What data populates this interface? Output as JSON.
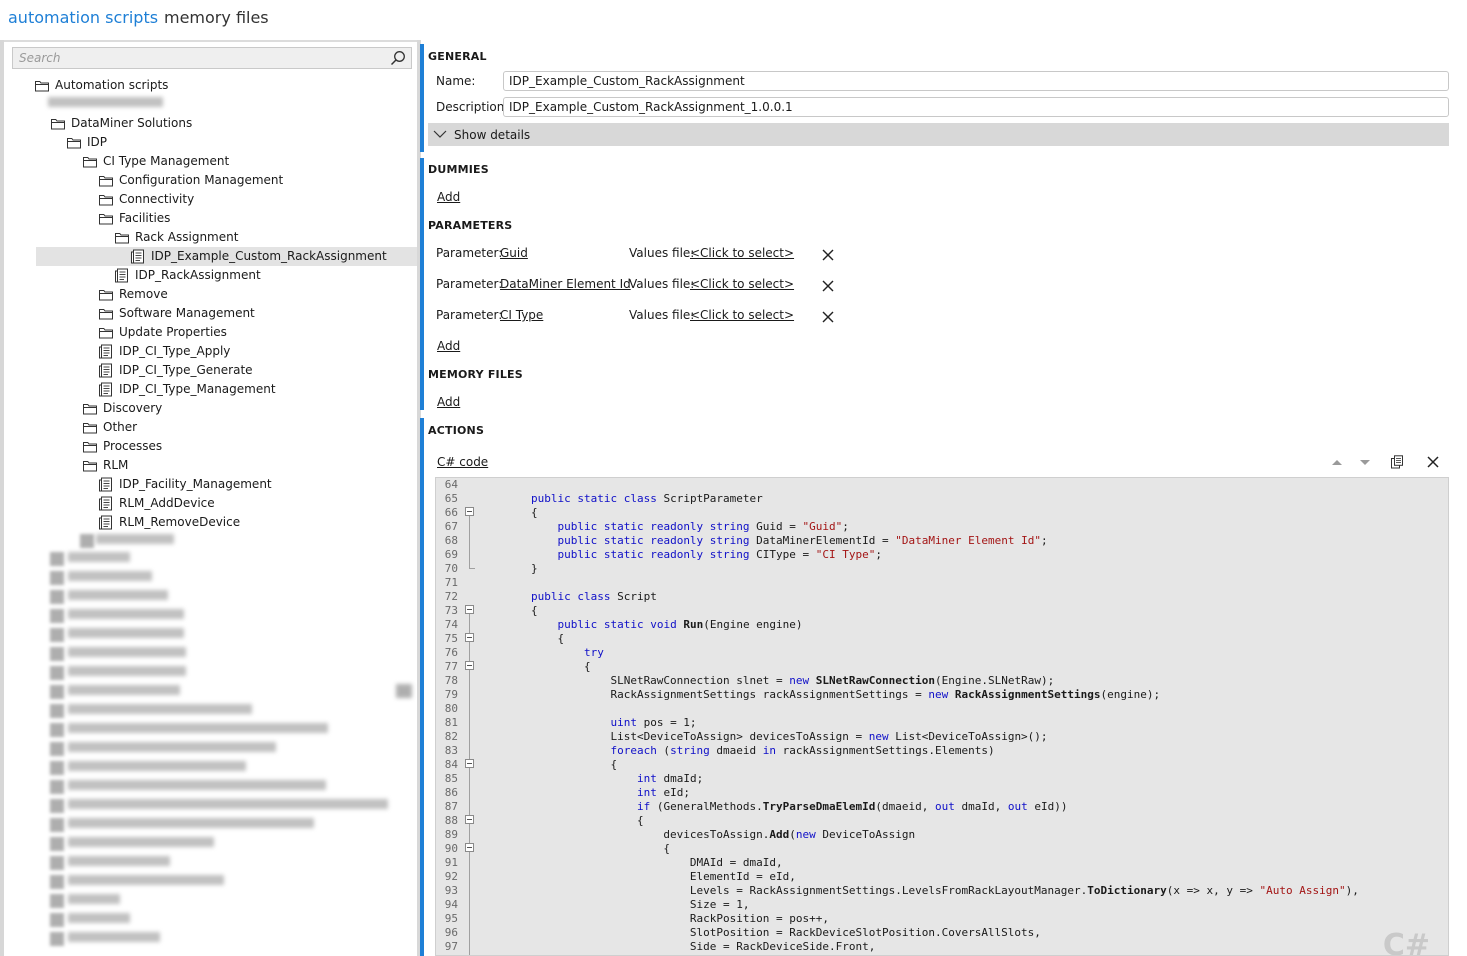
{
  "tabs": [
    {
      "label": "automation scripts",
      "active": true
    },
    {
      "label": "memory files",
      "active": false
    }
  ],
  "search": {
    "placeholder": "Search"
  },
  "tree": [
    {
      "label": "Automation scripts",
      "type": "folder",
      "level": 0
    },
    {
      "label": "DataMiner Solutions",
      "type": "folder",
      "level": 1
    },
    {
      "label": "IDP",
      "type": "folder",
      "level": 2
    },
    {
      "label": "CI Type Management",
      "type": "folder",
      "level": 3
    },
    {
      "label": "Configuration Management",
      "type": "folder",
      "level": 4
    },
    {
      "label": "Connectivity",
      "type": "folder",
      "level": 4
    },
    {
      "label": "Facilities",
      "type": "folder",
      "level": 4
    },
    {
      "label": "Rack Assignment",
      "type": "folder",
      "level": 5
    },
    {
      "label": "IDP_Example_Custom_RackAssignment",
      "type": "script",
      "level": 6,
      "selected": true
    },
    {
      "label": "IDP_RackAssignment",
      "type": "script",
      "level": 5
    },
    {
      "label": "Remove",
      "type": "folder",
      "level": 4
    },
    {
      "label": "Software Management",
      "type": "folder",
      "level": 4
    },
    {
      "label": "Update Properties",
      "type": "folder",
      "level": 4
    },
    {
      "label": "IDP_CI_Type_Apply",
      "type": "script",
      "level": 4
    },
    {
      "label": "IDP_CI_Type_Generate",
      "type": "script",
      "level": 4
    },
    {
      "label": "IDP_CI_Type_Management",
      "type": "script",
      "level": 4
    },
    {
      "label": "Discovery",
      "type": "folder",
      "level": 3
    },
    {
      "label": "Other",
      "type": "folder",
      "level": 3
    },
    {
      "label": "Processes",
      "type": "folder",
      "level": 3
    },
    {
      "label": "RLM",
      "type": "folder",
      "level": 3
    },
    {
      "label": "IDP_Facility_Management",
      "type": "script",
      "level": 4
    },
    {
      "label": "RLM_AddDevice",
      "type": "script",
      "level": 4
    },
    {
      "label": "RLM_RemoveDevice",
      "type": "script",
      "level": 4
    }
  ],
  "general": {
    "title": "GENERAL",
    "name_label": "Name:",
    "name_value": "IDP_Example_Custom_RackAssignment",
    "description_label": "Description:",
    "description_value": "IDP_Example_Custom_RackAssignment_1.0.0.1",
    "show_details": "Show details"
  },
  "dummies": {
    "title": "DUMMIES",
    "add": "Add"
  },
  "parameters": {
    "title": "PARAMETERS",
    "add": "Add",
    "items": [
      {
        "label": "Parameter:",
        "name": "Guid",
        "values_label": "Values file:",
        "values_link": "<Click to select>"
      },
      {
        "label": "Parameter:",
        "name": "DataMiner Element Id",
        "values_label": "Values file:",
        "values_link": "<Click to select>"
      },
      {
        "label": "Parameter:",
        "name": "CI Type",
        "values_label": "Values file:",
        "values_link": "<Click to select>"
      }
    ]
  },
  "memory_files": {
    "title": "MEMORY FILES",
    "add": "Add"
  },
  "actions": {
    "title": "ACTIONS",
    "code_tab": "C# code",
    "watermark": "C#",
    "line_numbers": [
      64,
      65,
      66,
      67,
      68,
      69,
      70,
      71,
      72,
      73,
      74,
      75,
      76,
      77,
      78,
      79,
      80,
      81,
      82,
      83,
      84,
      85,
      86,
      87,
      88,
      89,
      90,
      91,
      92,
      93,
      94,
      95,
      96,
      97
    ],
    "code_lines": [
      [],
      [
        [
          "        ",
          ""
        ],
        [
          "public static class",
          "kw"
        ],
        [
          " ScriptParameter",
          ""
        ]
      ],
      [
        [
          "        {",
          ""
        ]
      ],
      [
        [
          "            ",
          ""
        ],
        [
          "public static readonly string",
          "kw"
        ],
        [
          " Guid = ",
          ""
        ],
        [
          "\"Guid\"",
          "str"
        ],
        [
          ";",
          ""
        ]
      ],
      [
        [
          "            ",
          ""
        ],
        [
          "public static readonly string",
          "kw"
        ],
        [
          " DataMinerElementId = ",
          ""
        ],
        [
          "\"DataMiner Element Id\"",
          "str"
        ],
        [
          ";",
          ""
        ]
      ],
      [
        [
          "            ",
          ""
        ],
        [
          "public static readonly string",
          "kw"
        ],
        [
          " CIType = ",
          ""
        ],
        [
          "\"CI Type\"",
          "str"
        ],
        [
          ";",
          ""
        ]
      ],
      [
        [
          "        }",
          ""
        ]
      ],
      [],
      [
        [
          "        ",
          ""
        ],
        [
          "public class",
          "kw"
        ],
        [
          " Script",
          ""
        ]
      ],
      [
        [
          "        {",
          ""
        ]
      ],
      [
        [
          "            ",
          ""
        ],
        [
          "public static void",
          "kw"
        ],
        [
          " ",
          ""
        ],
        [
          "Run",
          "fn"
        ],
        [
          "(Engine engine)",
          ""
        ]
      ],
      [
        [
          "            {",
          ""
        ]
      ],
      [
        [
          "                ",
          ""
        ],
        [
          "try",
          "kw"
        ]
      ],
      [
        [
          "                {",
          ""
        ]
      ],
      [
        [
          "                    SLNetRawConnection slnet = ",
          ""
        ],
        [
          "new",
          "kw"
        ],
        [
          " ",
          ""
        ],
        [
          "SLNetRawConnection",
          "fn"
        ],
        [
          "(Engine.SLNetRaw);",
          ""
        ]
      ],
      [
        [
          "                    RackAssignmentSettings rackAssignmentSettings = ",
          ""
        ],
        [
          "new",
          "kw"
        ],
        [
          " ",
          ""
        ],
        [
          "RackAssignmentSettings",
          "fn"
        ],
        [
          "(engine);",
          ""
        ]
      ],
      [],
      [
        [
          "                    ",
          ""
        ],
        [
          "uint",
          "kw"
        ],
        [
          " pos = 1;",
          ""
        ]
      ],
      [
        [
          "                    List<DeviceToAssign> devicesToAssign = ",
          ""
        ],
        [
          "new",
          "kw"
        ],
        [
          " List<DeviceToAssign>();",
          ""
        ]
      ],
      [
        [
          "                    ",
          ""
        ],
        [
          "foreach",
          "kw"
        ],
        [
          " (",
          ""
        ],
        [
          "string",
          "kw"
        ],
        [
          " dmaeid ",
          ""
        ],
        [
          "in",
          "kw"
        ],
        [
          " rackAssignmentSettings.Elements)",
          ""
        ]
      ],
      [
        [
          "                    {",
          ""
        ]
      ],
      [
        [
          "                        ",
          ""
        ],
        [
          "int",
          "kw"
        ],
        [
          " dmaId;",
          ""
        ]
      ],
      [
        [
          "                        ",
          ""
        ],
        [
          "int",
          "kw"
        ],
        [
          " eId;",
          ""
        ]
      ],
      [
        [
          "                        ",
          ""
        ],
        [
          "if",
          "kw"
        ],
        [
          " (GeneralMethods.",
          ""
        ],
        [
          "TryParseDmaElemId",
          "fn"
        ],
        [
          "(dmaeid, ",
          ""
        ],
        [
          "out",
          "kw"
        ],
        [
          " dmaId, ",
          ""
        ],
        [
          "out",
          "kw"
        ],
        [
          " eId))",
          ""
        ]
      ],
      [
        [
          "                        {",
          ""
        ]
      ],
      [
        [
          "                            devicesToAssign.",
          ""
        ],
        [
          "Add",
          "fn"
        ],
        [
          "(",
          ""
        ],
        [
          "new",
          "kw"
        ],
        [
          " DeviceToAssign",
          ""
        ]
      ],
      [
        [
          "                            {",
          ""
        ]
      ],
      [
        [
          "                                DMAId = dmaId,",
          ""
        ]
      ],
      [
        [
          "                                ElementId = eId,",
          ""
        ]
      ],
      [
        [
          "                                Levels = RackAssignmentSettings.LevelsFromRackLayoutManager.",
          ""
        ],
        [
          "ToDictionary",
          "fn"
        ],
        [
          "(x => x, y => ",
          ""
        ],
        [
          "\"Auto Assign\"",
          "str"
        ],
        [
          "),",
          ""
        ]
      ],
      [
        [
          "                                Size = 1,",
          ""
        ]
      ],
      [
        [
          "                                RackPosition = pos++,",
          ""
        ]
      ],
      [
        [
          "                                SlotPosition = RackDeviceSlotPosition.CoversAllSlots,",
          ""
        ]
      ],
      [
        [
          "                                Side = RackDeviceSide.Front,",
          ""
        ]
      ]
    ]
  },
  "colors": {
    "accent": "#1e7fd6",
    "keyword": "#1010c8",
    "string": "#a31515"
  }
}
